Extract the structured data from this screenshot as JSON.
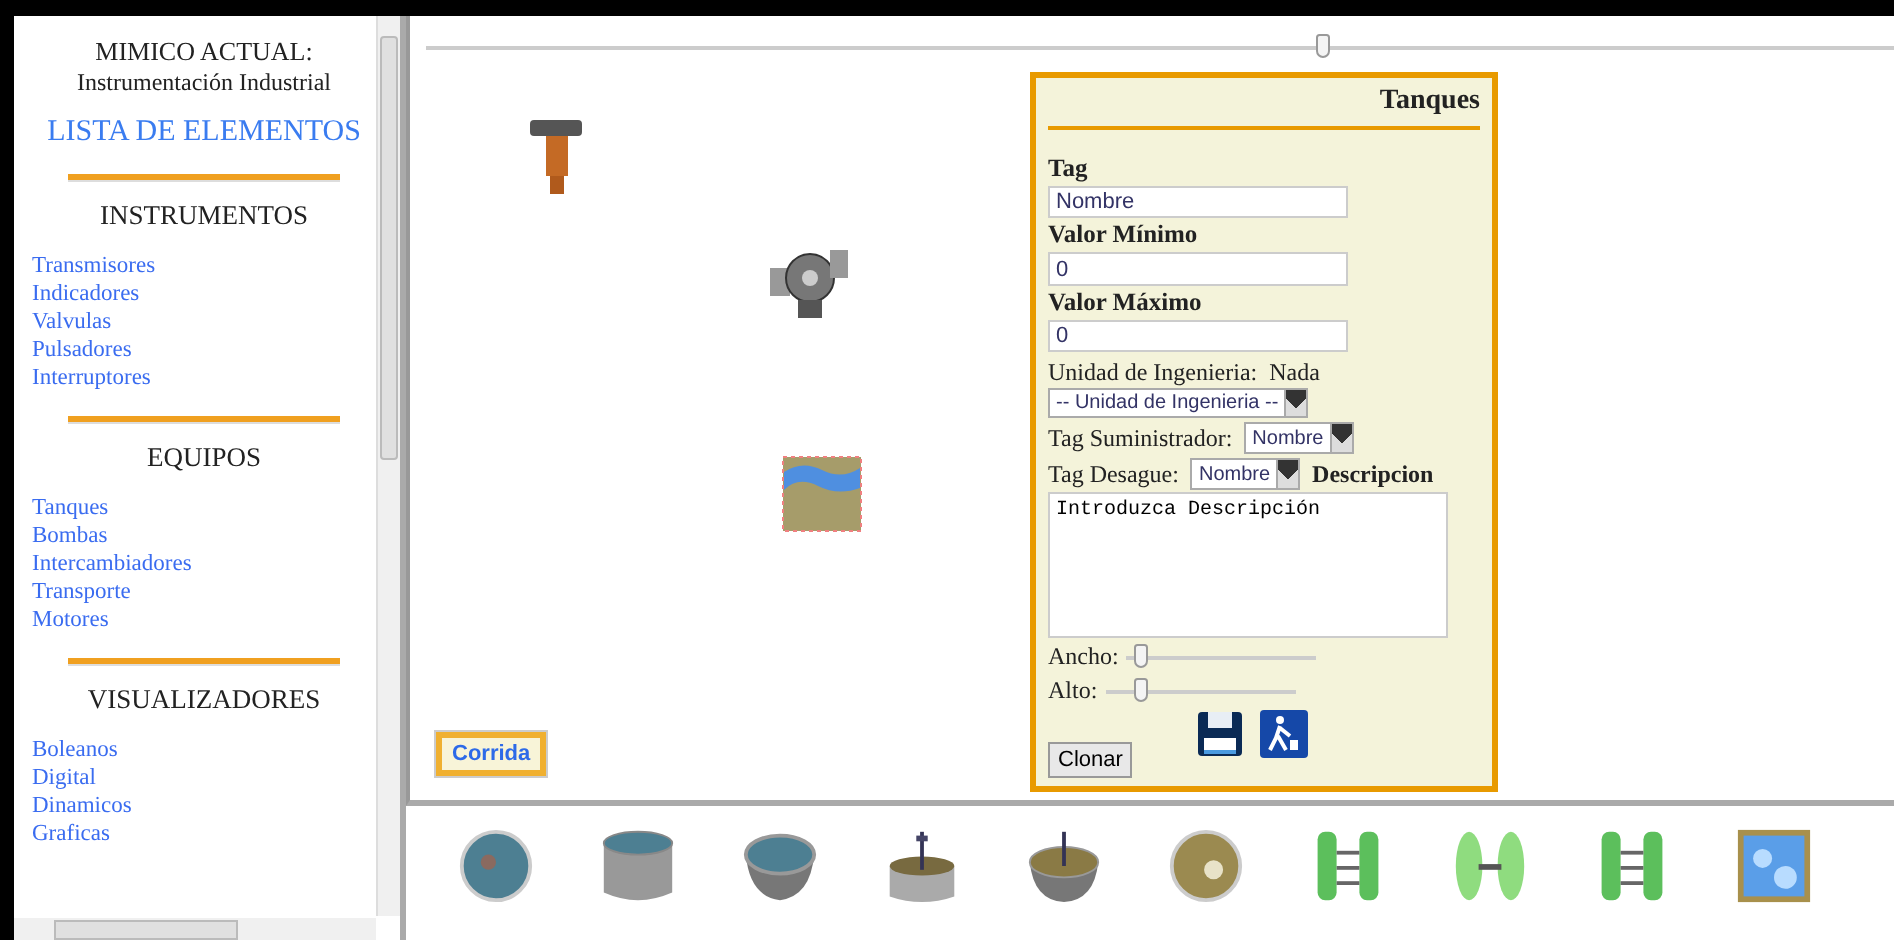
{
  "sidebar": {
    "title": "MIMICO ACTUAL:",
    "subtitle": "Instrumentación Industrial",
    "list_heading": "LISTA DE ELEMENTOS",
    "sections": [
      {
        "heading": "INSTRUMENTOS",
        "items": [
          "Transmisores",
          "Indicadores",
          "Valvulas",
          "Pulsadores",
          "Interruptores"
        ]
      },
      {
        "heading": "EQUIPOS",
        "items": [
          "Tanques",
          "Bombas",
          "Intercambiadores",
          "Transporte",
          "Motores"
        ]
      },
      {
        "heading": "VISUALIZADORES",
        "items": [
          "Boleanos",
          "Digital",
          "Dinamicos",
          "Graficas"
        ]
      }
    ]
  },
  "canvas": {
    "zoom_slider": {
      "level": 0.61
    },
    "elements": [
      {
        "kind": "transmitter"
      },
      {
        "kind": "pump"
      },
      {
        "kind": "tank"
      }
    ],
    "run_button": "Corrida"
  },
  "panel": {
    "title": "Tanques",
    "tag": {
      "label": "Tag",
      "value": "Nombre"
    },
    "min": {
      "label": "Valor Mínimo",
      "value": "0"
    },
    "max": {
      "label": "Valor Máximo",
      "value": "0"
    },
    "unit": {
      "label": "Unidad de Ingenieria:",
      "value": "Nada",
      "select": "-- Unidad de Ingenieria --"
    },
    "supply": {
      "label": "Tag Suministrador:",
      "select": "Nombre"
    },
    "drain": {
      "label": "Tag Desague:",
      "select": "Nombre"
    },
    "description": {
      "label": "Descripcion",
      "value": "Introduzca Descripción"
    },
    "width": {
      "label": "Ancho:",
      "level": 0.07
    },
    "height": {
      "label": "Alto:",
      "level": 0.18
    },
    "clone_button": "Clonar"
  },
  "palette": {
    "items": [
      {
        "kind": "round-top"
      },
      {
        "kind": "cylinder"
      },
      {
        "kind": "bowl"
      },
      {
        "kind": "mixer"
      },
      {
        "kind": "mixer-bowl"
      },
      {
        "kind": "sand-top"
      },
      {
        "kind": "exchanger"
      },
      {
        "kind": "disc-exchanger"
      },
      {
        "kind": "exchanger"
      },
      {
        "kind": "water"
      }
    ]
  }
}
